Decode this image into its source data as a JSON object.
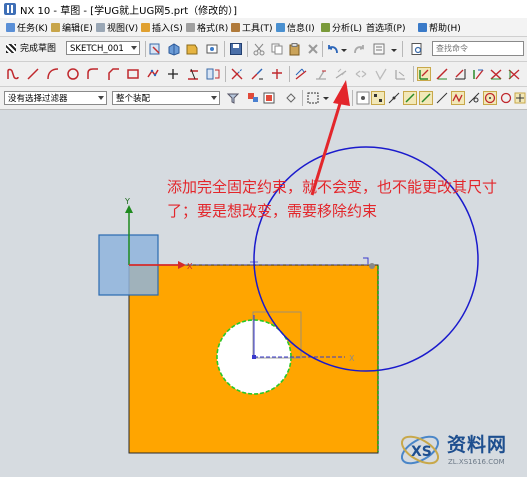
{
  "window": {
    "title": "NX 10 - 草图 - [学UG就上UG网5.prt（修改的）]"
  },
  "menu": [
    "任务(K)",
    "编辑(E)",
    "视图(V)",
    "插入(S)",
    "格式(R)",
    "工具(T)",
    "信息(I)",
    "分析(L)",
    "首选项(P)",
    "帮助(H)"
  ],
  "toolbar": {
    "finish_sketch_label": "完成草图",
    "sketch_name": "SKETCH_001",
    "search_placeholder": "查找命令"
  },
  "filter_bar": {
    "selection_filter": "没有选择过滤器",
    "assembly_scope": "整个装配"
  },
  "graphics": {
    "axis_y_label": "Y",
    "axis_x_label": "X",
    "hole_axis_label": "X",
    "plate_color": "#ffa500",
    "circle_color": "#1a1acc",
    "arrow_color": "#e3262b"
  },
  "annotation": {
    "text": "添加完全固定约束，就不会变，也不能更改其尺寸了；要是想改变，需要移除约束"
  },
  "watermark": {
    "name": "资料网",
    "url": "ZL.XS1616.COM"
  }
}
